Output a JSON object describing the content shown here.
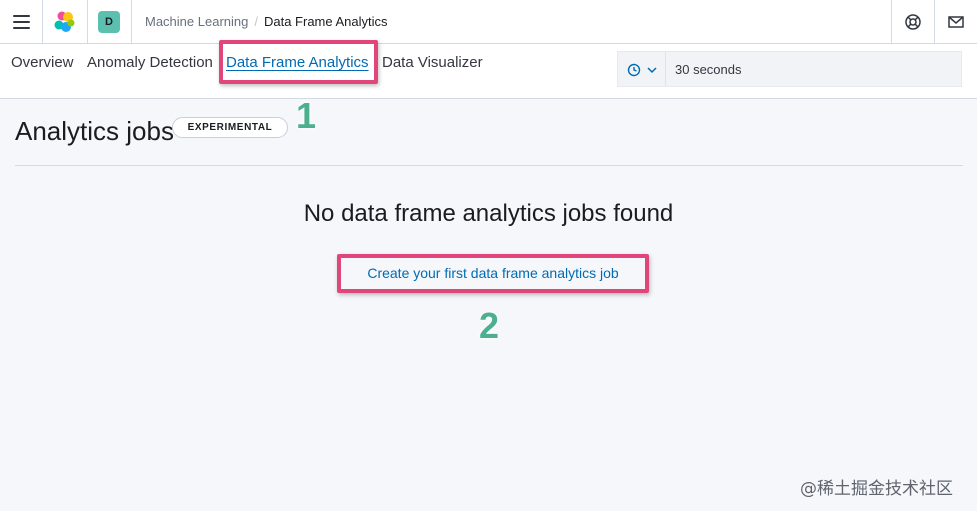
{
  "header": {
    "menu_icon": "hamburger-icon",
    "logo_icon": "elastic-logo-icon",
    "space_avatar": "D",
    "breadcrumbs": [
      "Machine Learning",
      "Data Frame Analytics"
    ],
    "help_icon": "help-lifebuoy-icon",
    "mail_icon": "mail-icon"
  },
  "tabs": [
    {
      "label": "Overview"
    },
    {
      "label": "Anomaly Detection"
    },
    {
      "label": "Data Frame Analytics",
      "selected": true
    },
    {
      "label": "Data Visualizer"
    }
  ],
  "refresh": {
    "icon": "clock-icon",
    "dropdown_icon": "chevron-down-icon",
    "interval": "30 seconds"
  },
  "page": {
    "title": "Analytics jobs",
    "badge": "EXPERIMENTAL",
    "empty_title": "No data frame analytics jobs found",
    "create_link": "Create your first data frame analytics job"
  },
  "annotations": {
    "step_1": "1",
    "step_2": "2",
    "highlight_color": "#e0467a",
    "number_color": "#4caf8e"
  },
  "watermark": "@稀土掘金技术社区",
  "colors": {
    "link": "#006bb4",
    "space_avatar_bg": "#5bc0b0",
    "page_bg": "#f5f7fa"
  }
}
